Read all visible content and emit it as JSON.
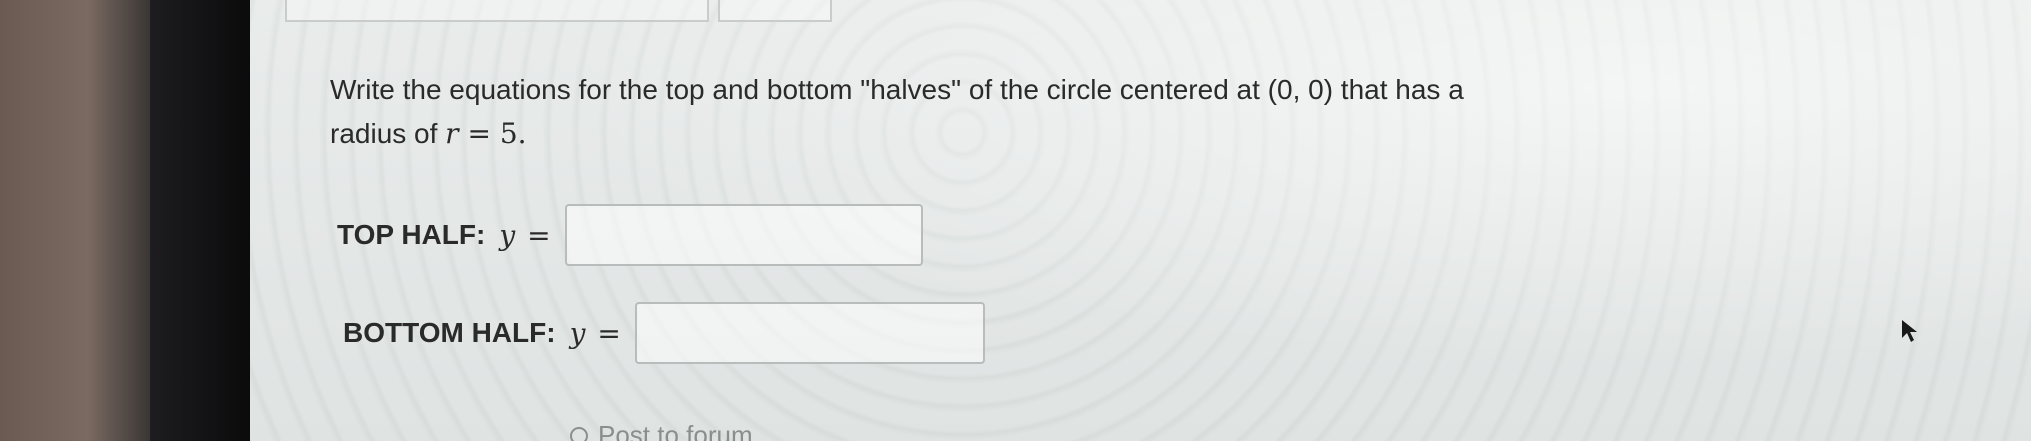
{
  "question": {
    "text_part1": "Write the equations for the top and bottom \"halves\" of the circle centered at (0, 0) that has a",
    "text_part2": "radius of ",
    "math_r": "r",
    "math_eq": " = 5."
  },
  "top_half": {
    "label": "TOP HALF:",
    "variable": "y",
    "equals": "=",
    "value": ""
  },
  "bottom_half": {
    "label": "BOTTOM HALF:",
    "variable": "y",
    "equals": "=",
    "value": ""
  },
  "footer": {
    "post_link": "Post to forum"
  },
  "colors": {
    "text": "#2a2a2a",
    "box_border": "#b8bcbb",
    "link": "#8a8f8e"
  }
}
